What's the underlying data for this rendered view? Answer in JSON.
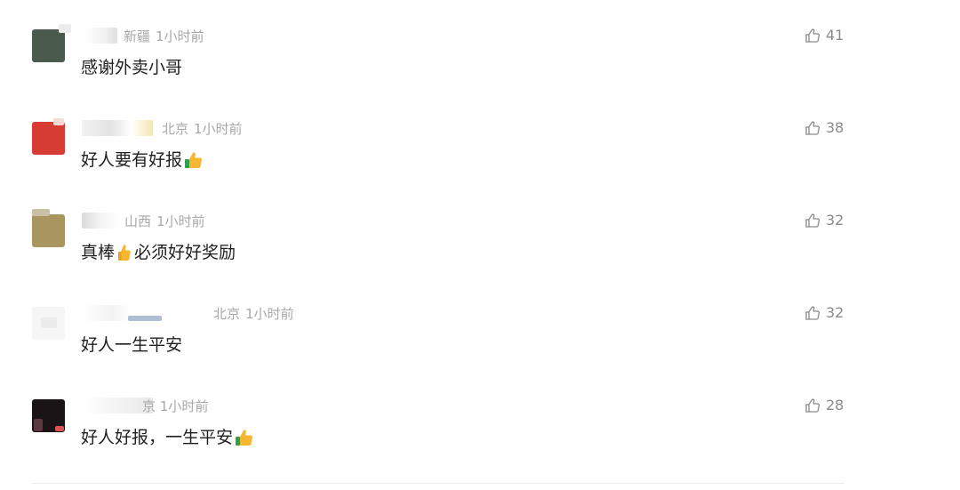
{
  "comments": [
    {
      "location": "新疆",
      "time": "1小时前",
      "content": "感谢外卖小哥",
      "likes": "41",
      "avatar_color": "#4a5a4d"
    },
    {
      "location": "北京",
      "time": "1小时前",
      "content": "好人要有好报",
      "likes": "38",
      "avatar_color": "#d73c34"
    },
    {
      "location": "山西",
      "time": "1小时前",
      "content_before": "真棒",
      "content_after": "必须好好奖励",
      "likes": "32",
      "avatar_color": "#a8955f"
    },
    {
      "location": "北京",
      "time": "1小时前",
      "content": "好人一生平安",
      "likes": "32",
      "avatar_color": "#f2f2f2"
    },
    {
      "location": "京",
      "time": "1小时前",
      "content": "好人好报，一生平安",
      "likes": "28",
      "avatar_color": "#1a1416"
    }
  ],
  "icons": {
    "like": "thumbs-up-outline-icon",
    "emoji": "thumbs-up-emoji-icon"
  },
  "colors": {
    "meta_text": "#a8a8a8",
    "content_text": "#1f1f1f",
    "like_text": "#8a8a8a",
    "divider": "#ececec",
    "emoji_hand": "#f5b731",
    "emoji_cuff": "#2e9f4a"
  }
}
